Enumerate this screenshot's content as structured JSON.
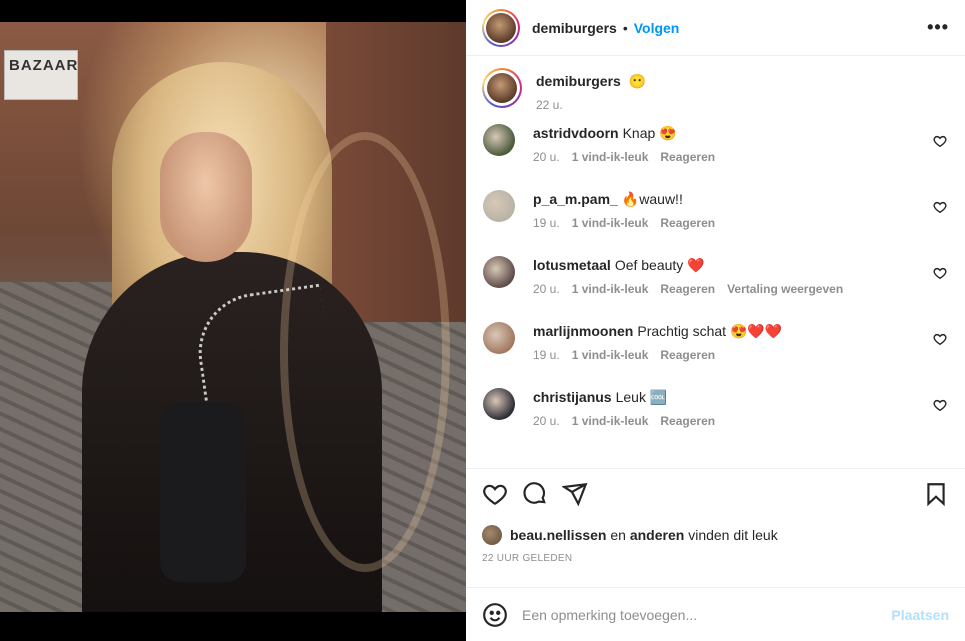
{
  "post": {
    "author": "demiburgers",
    "follow_label": "Volgen",
    "separator": "•",
    "more_label": "•••",
    "photo_sign": "BAZAAR"
  },
  "caption": {
    "user": "demiburgers",
    "text": "😶",
    "time": "22 u."
  },
  "comments": [
    {
      "user": "astridvdoorn",
      "text": "Knap 😍",
      "time": "20 u.",
      "likes": "1 vind-ik-leuk",
      "reply": "Reageren",
      "extra": "",
      "avatar_color": "#4a5a3a"
    },
    {
      "user": "p_a_m.pam_",
      "text": "🔥wauw!!",
      "time": "19 u.",
      "likes": "1 vind-ik-leuk",
      "reply": "Reageren",
      "extra": "",
      "avatar_color": "#b7b3a6"
    },
    {
      "user": "lotusmetaal",
      "text": "Oef beauty ❤️",
      "time": "20 u.",
      "likes": "1 vind-ik-leuk",
      "reply": "Reageren",
      "extra": "Vertaling weergeven",
      "avatar_color": "#5e4c48"
    },
    {
      "user": "marlijnmoonen",
      "text": "Prachtig schat 😍❤️❤️",
      "time": "19 u.",
      "likes": "1 vind-ik-leuk",
      "reply": "Reageren",
      "extra": "",
      "avatar_color": "#a27860"
    },
    {
      "user": "christijanus",
      "text": "Leuk 🆒",
      "time": "20 u.",
      "likes": "1 vind-ik-leuk",
      "reply": "Reageren",
      "extra": "",
      "avatar_color": "#2d2c36"
    }
  ],
  "likes": {
    "user": "beau.nellissen",
    "en": "en",
    "others": "anderen",
    "suffix": "vinden dit leuk"
  },
  "time_ago": "22 UUR GELEDEN",
  "add_comment": {
    "placeholder": "Een opmerking toevoegen...",
    "post_label": "Plaatsen"
  },
  "icons": {
    "like": "heart-icon",
    "comment": "comment-icon",
    "share": "paper-plane-icon",
    "save": "bookmark-icon",
    "emoji": "smiley-icon"
  },
  "colors": {
    "accent": "#0095f6",
    "post_disabled": "#b2dffc",
    "muted": "#8e8e8e"
  }
}
